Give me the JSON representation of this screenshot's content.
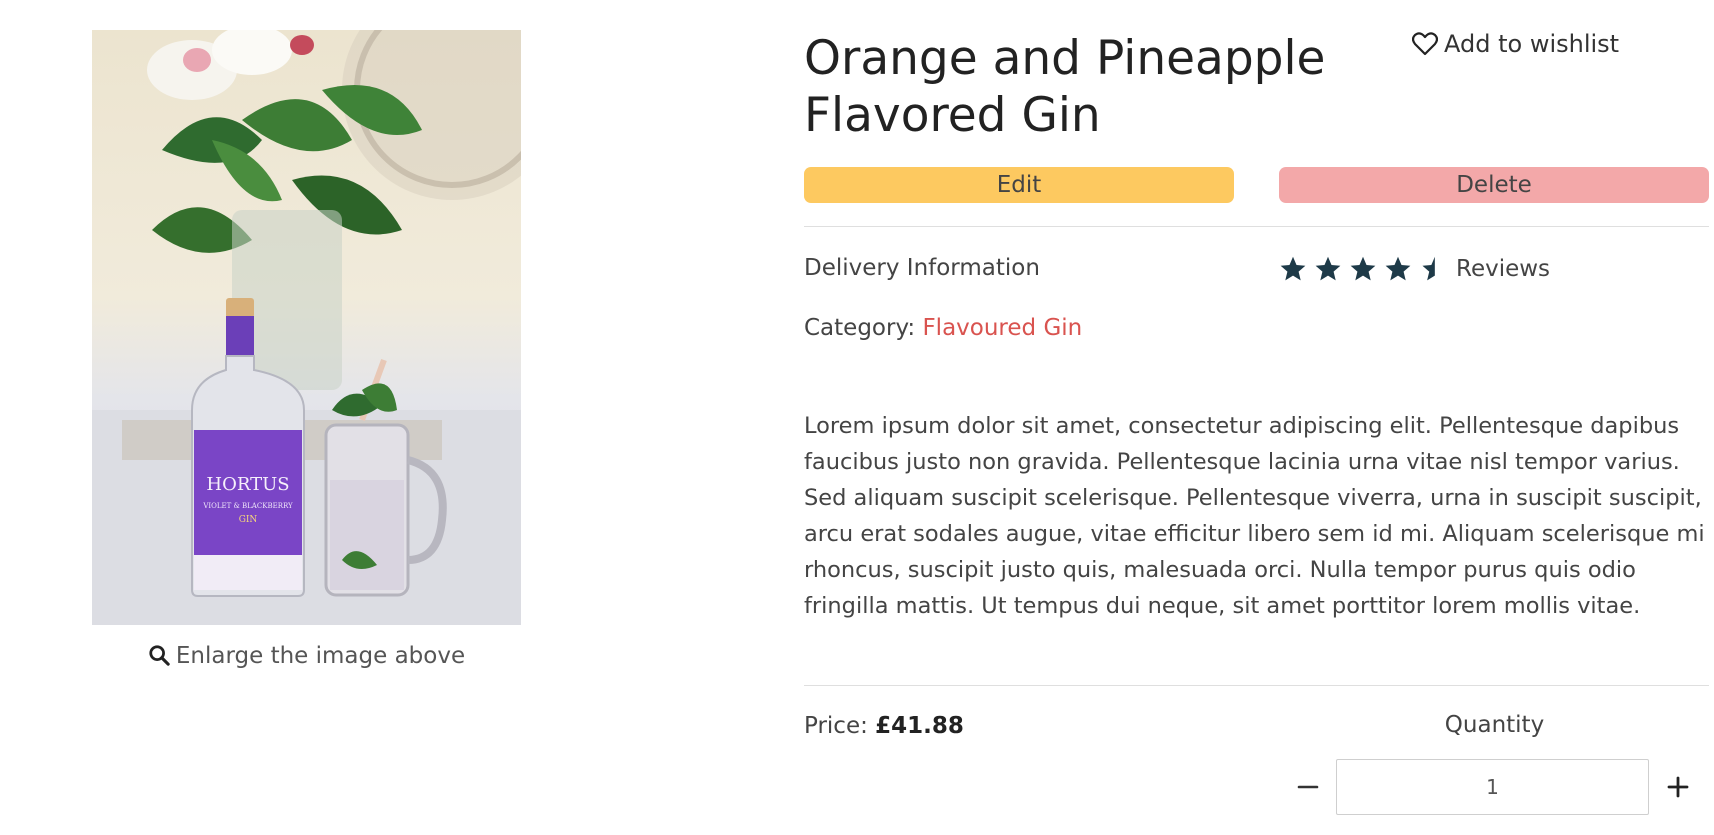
{
  "product": {
    "title": "Orange and Pineapple Flavored Gin",
    "image_alt": "Hortus violet and blackberry gin bottle next to a glass jar with mint",
    "bottle_brand": "HORTUS",
    "bottle_sub": "VIOLET & BLACKBERRY",
    "bottle_gin": "GIN",
    "category_label": "Category:",
    "category_value": "Flavoured Gin",
    "description": "Lorem ipsum dolor sit amet, consectetur adipiscing elit. Pellentesque dapibus faucibus justo non gravida. Pellentesque lacinia urna vitae nisl tempor varius. Sed aliquam suscipit scelerisque. Pellentesque viverra, urna in suscipit suscipit, arcu erat sodales augue, vitae efficitur libero sem id mi. Aliquam scelerisque mi rhoncus, suscipit justo quis, malesuada orci. Nulla tempor purus quis odio fringilla mattis. Ut tempus dui neque, sit amet porttitor lorem mollis vitae.",
    "price_label": "Price:",
    "price_value": "£41.88",
    "rating": 4.5
  },
  "actions": {
    "enlarge_label": "Enlarge the image above",
    "wishlist_label": "Add to wishlist",
    "edit_label": "Edit",
    "delete_label": "Delete",
    "delivery_label": "Delivery Information",
    "reviews_label": "Reviews"
  },
  "quantity": {
    "label": "Quantity",
    "value": "1"
  },
  "icons": {
    "enlarge": "search-icon",
    "wishlist": "heart-outline-icon",
    "star": "star-icon",
    "star_half": "star-half-icon",
    "minus": "minus-icon",
    "plus": "plus-icon"
  },
  "colors": {
    "edit_button": "#fdc960",
    "delete_button": "#f3a8a9",
    "category_link": "#d9534f",
    "stars": "#1e3a48"
  }
}
